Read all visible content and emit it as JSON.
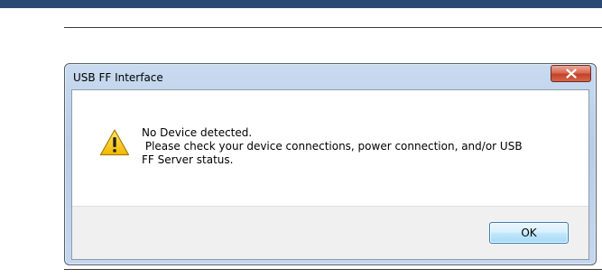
{
  "dialog": {
    "title": "USB FF Interface",
    "close_icon": "close-icon",
    "warning_icon": "warning-icon",
    "message_lines": [
      "No Device detected.",
      " Please check your device connections, power connection, and/or USB",
      "FF Server status."
    ],
    "ok_label": "OK"
  },
  "colors": {
    "top_band": "#2a4a73",
    "title_bar": "#b9cfe8",
    "close_button": "#c94a32",
    "ok_button_border": "#3c7fb1",
    "warning_yellow": "#f5c400"
  }
}
